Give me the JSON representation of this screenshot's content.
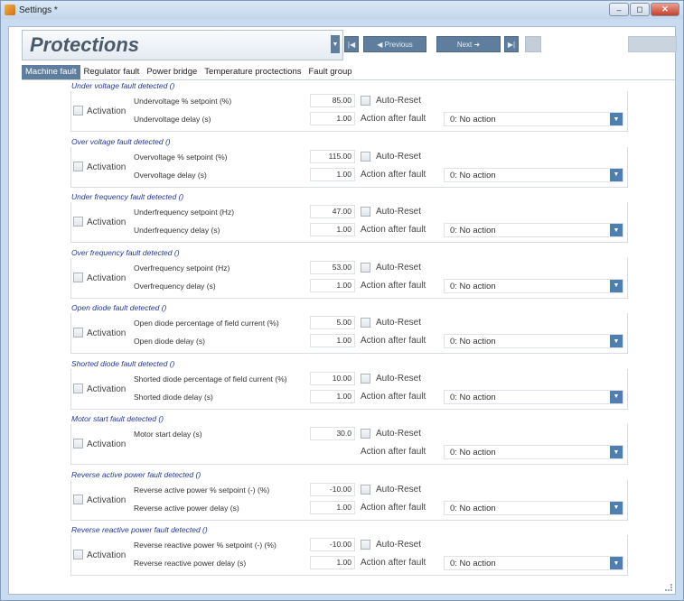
{
  "window": {
    "title": "Settings *",
    "controls": [
      "–",
      "◻",
      "✕"
    ]
  },
  "header": {
    "title": "Protections",
    "nav": {
      "first": "|◀",
      "previous": "◀  Previous",
      "next": "Next  ➜",
      "last": "▶|",
      "disabled": "",
      "right": ""
    }
  },
  "tabs": [
    {
      "label": "Machine fault",
      "active": true
    },
    {
      "label": "Regulator fault"
    },
    {
      "label": "Power bridge"
    },
    {
      "label": "Temperature proctections"
    },
    {
      "label": "Fault group"
    }
  ],
  "common": {
    "activation": "Activation",
    "auto_reset": "Auto-Reset",
    "action_after_fault": "Action after fault"
  },
  "groups": [
    {
      "title": "Under voltage fault detected ()",
      "p1_label": "Undervoltage % setpoint (%)",
      "p1_value": "85.00",
      "p2_label": "Undervoltage delay (s)",
      "p2_value": "1.00",
      "action": "0: No action"
    },
    {
      "title": "Over voltage fault detected ()",
      "p1_label": "Overvoltage % setpoint (%)",
      "p1_value": "115.00",
      "p2_label": "Overvoltage delay (s)",
      "p2_value": "1.00",
      "action": "0: No action"
    },
    {
      "title": "Under frequency fault detected  ()",
      "p1_label": "Underfrequency setpoint (Hz)",
      "p1_value": "47.00",
      "p2_label": "Underfrequency delay (s)",
      "p2_value": "1.00",
      "action": "0: No action"
    },
    {
      "title": "Over frequency fault detected ()",
      "p1_label": "Overfrequency setpoint (Hz)",
      "p1_value": "53.00",
      "p2_label": "Overfrequency delay (s)",
      "p2_value": "1.00",
      "action": "0: No action"
    },
    {
      "title": "Open diode fault detected ()",
      "p1_label": "Open diode percentage of field current (%)",
      "p1_value": "5.00",
      "p2_label": "Open diode delay (s)",
      "p2_value": "1.00",
      "action": "0: No action"
    },
    {
      "title": "Shorted diode fault detected ()",
      "p1_label": "Shorted diode percentage of field current (%)",
      "p1_value": "10.00",
      "p2_label": "Shorted diode delay (s)",
      "p2_value": "1.00",
      "action": "0: No action"
    },
    {
      "title": "Motor start fault detected ()",
      "p1_label": "Motor start delay (s)",
      "p1_value": "30.0",
      "p2_label": "",
      "p2_value": "",
      "action": "0: No action"
    },
    {
      "title": "Reverse active power fault detected ()",
      "p1_label": "Reverse active power % setpoint (-) (%)",
      "p1_value": "-10.00",
      "p2_label": "Reverse active power delay (s)",
      "p2_value": "1.00",
      "action": "0: No action"
    },
    {
      "title": "Reverse reactive power fault detected ()",
      "p1_label": "Reverse reactive power % setpoint (-) (%)",
      "p1_value": "-10.00",
      "p2_label": "Reverse reactive power delay (s)",
      "p2_value": "1.00",
      "action": "0: No action"
    }
  ],
  "colors": {
    "accent": "#5f7d9c",
    "group_title": "#23399a",
    "dropdown_button": "#4e7fb0"
  }
}
